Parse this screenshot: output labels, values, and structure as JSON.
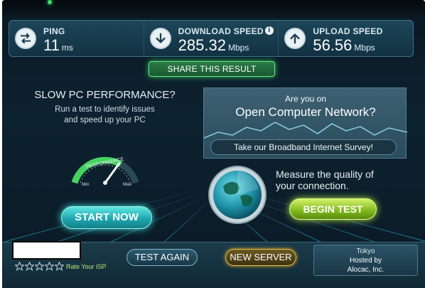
{
  "results": {
    "ping": {
      "label": "PING",
      "value": "11",
      "unit": "ms",
      "icon": "swap-arrows-icon"
    },
    "download": {
      "label": "DOWNLOAD SPEED",
      "value": "285.32",
      "unit": "Mbps",
      "icon": "arrow-down-icon",
      "info": "i"
    },
    "upload": {
      "label": "UPLOAD SPEED",
      "value": "56.56",
      "unit": "Mbps",
      "icon": "arrow-up-icon"
    }
  },
  "share_label": "SHARE THIS RESULT",
  "left_panel": {
    "title": "SLOW PC PERFORMANCE?",
    "subtitle_line1": "Run a test to identify issues",
    "subtitle_line2": "and speed up your PC",
    "gauge_label": "PERFORMANCE",
    "gauge_min": "Min",
    "gauge_max": "Max",
    "gauge_level": 0.7,
    "start_label": "START NOW"
  },
  "right_panel": {
    "line1": "Are you on",
    "line2": "Open Computer Network?",
    "survey_label": "Take our Broadband Internet Survey!",
    "measure_line1": "Measure the quality of",
    "measure_line2": "your connection.",
    "begin_label": "BEGIN TEST"
  },
  "bottom": {
    "rating": 0,
    "rating_max": 5,
    "rate_isp_label": "Rate Your ISP",
    "test_again_label": "TEST AGAIN",
    "new_server_label": "NEW SERVER",
    "server_city": "Tokyo",
    "hosted_by_label": "Hosted by",
    "host_name": "Alocac, Inc."
  },
  "colors": {
    "accent_green": "#2fbf5b",
    "accent_cyan": "#3ee0e0",
    "accent_lime": "#b6e84a",
    "accent_gold": "#e8c24a"
  }
}
